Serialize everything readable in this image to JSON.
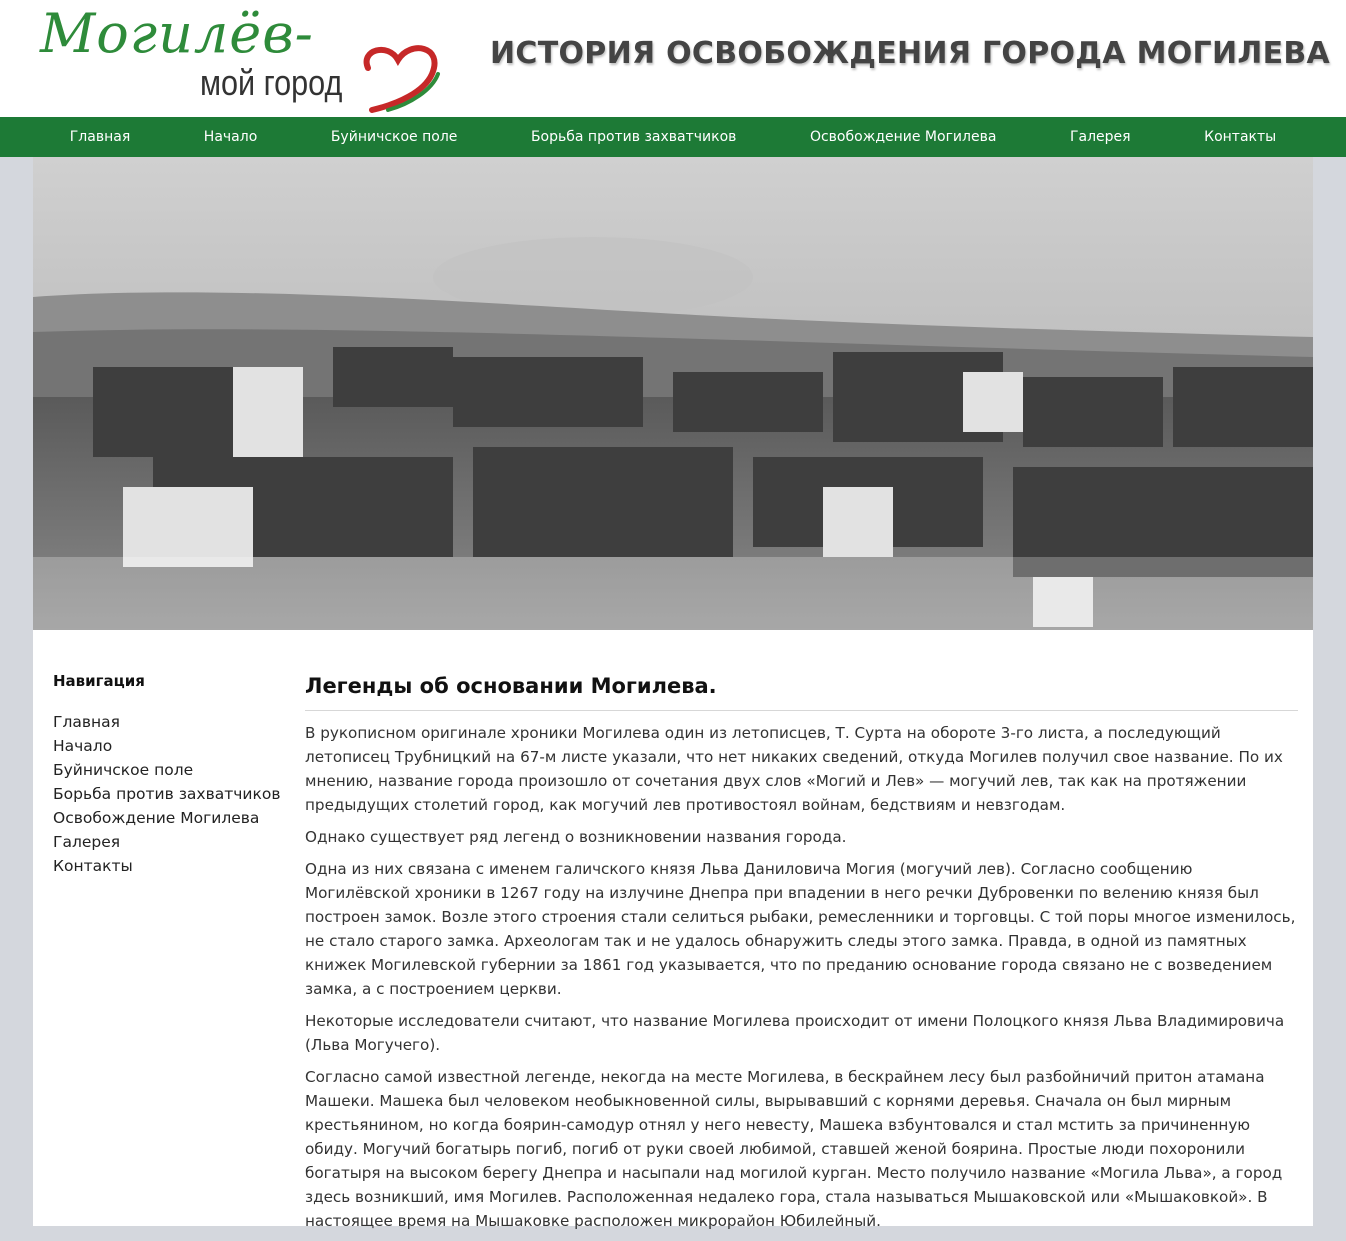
{
  "header": {
    "logo_script": "Могилёв-",
    "logo_sub": "мой город",
    "title": "ИСТОРИЯ ОСВОБОЖДЕНИЯ ГОРОДА МОГИЛЕВА"
  },
  "topnav": {
    "items": [
      "Главная",
      "Начало",
      "Буйничское поле",
      "Борьба против захватчиков",
      "Освобождение Могилева",
      "Галерея",
      "Контакты"
    ]
  },
  "sidebar": {
    "title": "Навигация",
    "items": [
      "Главная",
      "Начало",
      "Буйничское поле",
      "Борьба против захватчиков",
      "Освобождение Могилева",
      "Галерея",
      "Контакты"
    ]
  },
  "article": {
    "heading": "Легенды об основании Могилева.",
    "paragraphs": [
      "В рукописном оригинале хроники Могилева один из летописцев, Т. Сурта на обороте 3-го листа, а последующий летописец Трубницкий на 67-м листе указали, что нет никаких сведений, откуда Могилев получил свое название. По их мнению, название города произошло от сочетания двух слов «Могий и Лев» — могучий лев, так как на протяжении предыдущих столетий город, как могучий лев противостоял войнам, бедствиям и невзгодам.",
      "Однако существует ряд легенд о возникновении названия города.",
      "Одна из них связана с именем галичского князя Льва Даниловича Могия (могучий лев). Согласно сообщению Могилёвской хроники в 1267 году на излучине Днепра при впадении в него речки Дубровенки по велению князя был построен замок. Возле этого строения стали селиться рыбаки, ремесленники и торговцы. С той поры многое изменилось, не стало старого замка. Археологам так и не удалось обнаружить следы этого замка. Правда, в одной из памятных книжек Могилевской губернии за 1861 год указывается, что по преданию основание города связано не с возведением замка, а с построением церкви.",
      "Некоторые исследователи считают, что название Могилева происходит от имени Полоцкого князя Льва Владимировича (Льва Могучего).",
      "Согласно самой известной легенде, некогда на месте Могилева, в бескрайнем лесу был разбойничий притон атамана Машеки. Машека был человеком необыкновенной силы, вырывавший с корнями деревья. Сначала он был мирным крестьянином, но когда боярин-самодур отнял у него невесту, Машека взбунтовался и стал мстить за причиненную обиду. Могучий богатырь погиб, погиб от руки своей любимой, ставшей женой боярина. Простые люди похоронили богатыря на высоком берегу Днепра и насыпали над могилой курган. Место получило название «Могила Льва», а город здесь возникший, имя Могилев. Расположенная недалеко гора, стала называться Мышаковской или «Мышаковкой». В настоящее время на Мышаковке расположен микрорайон Юбилейный."
    ]
  },
  "colors": {
    "nav_green": "#1d7a36",
    "logo_green": "#2e8b3a",
    "heart_red": "#c62828",
    "page_bg": "#d4d7dd"
  },
  "icons": [
    "heart-icon"
  ]
}
